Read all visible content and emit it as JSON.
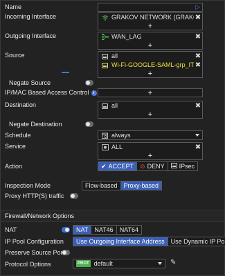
{
  "name": {
    "label": "Name",
    "value": ""
  },
  "incoming": {
    "label": "Incoming Interface",
    "value": "GRAKOV NETWORK (GRAKOV",
    "add": "+"
  },
  "outgoing": {
    "label": "Outgoing Interface",
    "value": "WAN_LAG",
    "add": "+"
  },
  "source": {
    "label": "Source",
    "items": [
      "all",
      "Wi-Fi-GOOGLE-SAML-grp_IT-Sup"
    ],
    "add": "+"
  },
  "negate_source": {
    "label": "Negate Source"
  },
  "ipmac": {
    "label": "IP/MAC Based Access Control",
    "add": "+"
  },
  "destination": {
    "label": "Destination",
    "items": [
      "all"
    ],
    "add": "+"
  },
  "negate_destination": {
    "label": "Negate Destination"
  },
  "schedule": {
    "label": "Schedule",
    "value": "always"
  },
  "service": {
    "label": "Service",
    "items": [
      "ALL"
    ],
    "add": "+"
  },
  "action": {
    "label": "Action",
    "options": [
      "ACCEPT",
      "DENY",
      "IPsec"
    ],
    "selected": "ACCEPT"
  },
  "inspection": {
    "label": "Inspection Mode",
    "options": [
      "Flow-based",
      "Proxy-based"
    ],
    "selected": "Proxy-based"
  },
  "proxy_traffic": {
    "label": "Proxy HTTP(S) traffic"
  },
  "firewall_section": {
    "title": "Firewall/Network Options"
  },
  "nat": {
    "label": "NAT",
    "options": [
      "NAT",
      "NAT46",
      "NAT64"
    ],
    "selected": "NAT"
  },
  "ip_pool": {
    "label": "IP Pool Configuration",
    "options": [
      "Use Outgoing Interface Address",
      "Use Dynamic IP Pool"
    ],
    "selected": "Use Outgoing Interface Address"
  },
  "preserve_port": {
    "label": "Preserve Source Port"
  },
  "protocol_options": {
    "label": "Protocol Options",
    "badge": "PROT",
    "value": "default"
  },
  "colors": {
    "accent": "#3b5fb5",
    "highlight_text": "#f0e040",
    "background": "#222222",
    "toggle_on": "#3a6fd1"
  }
}
